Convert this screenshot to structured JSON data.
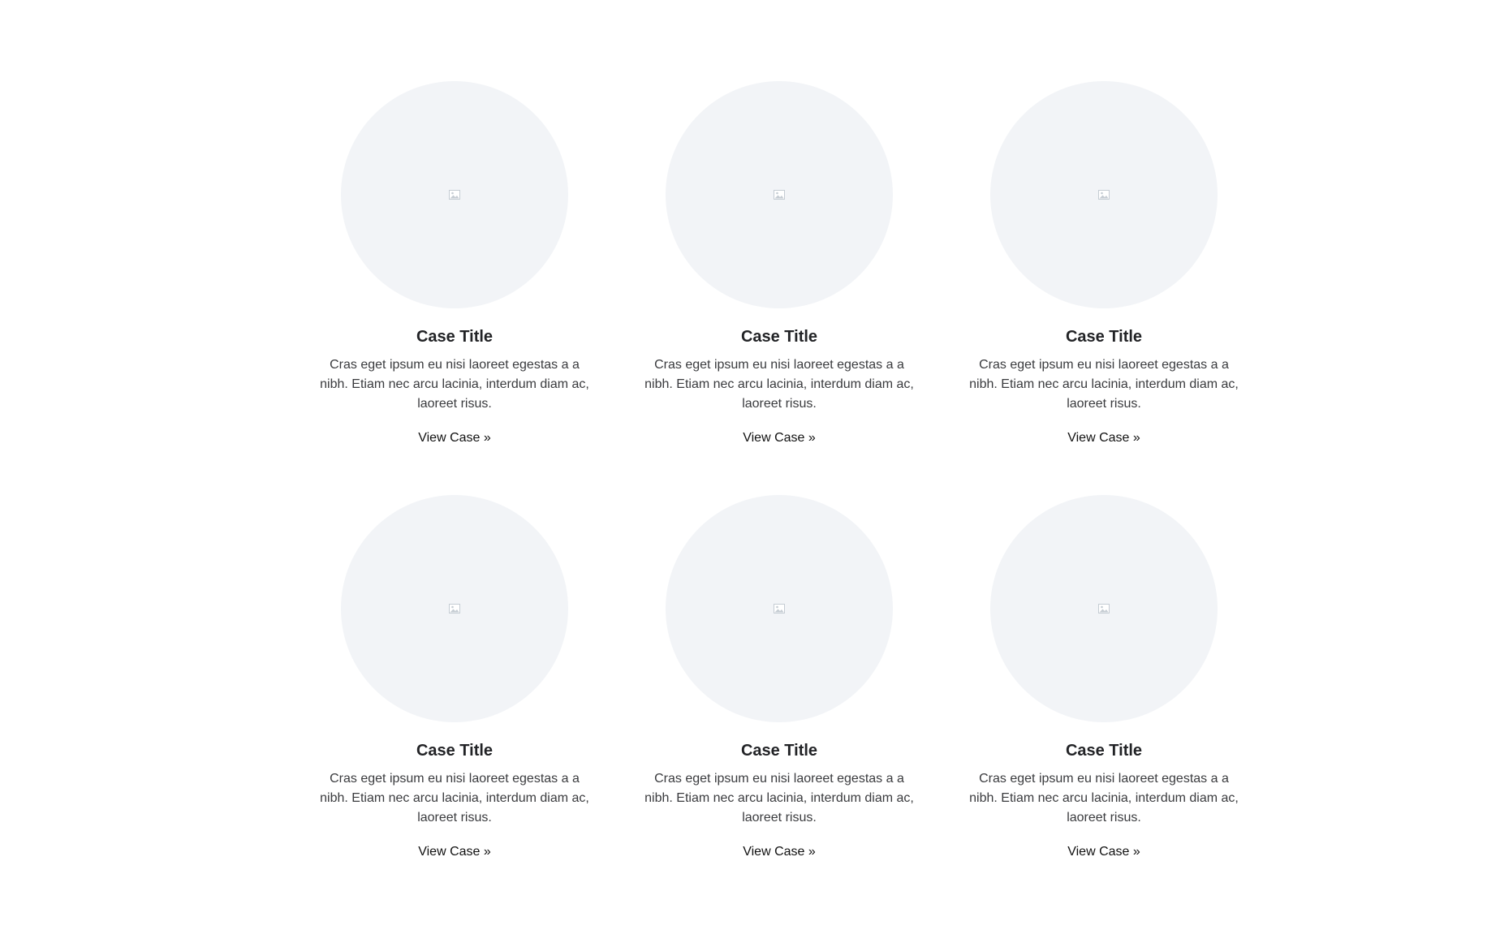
{
  "cases": [
    {
      "title": "Case Title",
      "description": "Cras eget ipsum eu nisi laoreet egestas a a nibh. Etiam nec arcu lacinia, interdum diam ac, laoreet risus.",
      "link_label": "View Case »",
      "image_icon": "broken-image-icon"
    },
    {
      "title": "Case Title",
      "description": "Cras eget ipsum eu nisi laoreet egestas a a nibh. Etiam nec arcu lacinia, interdum diam ac, laoreet risus.",
      "link_label": "View Case »",
      "image_icon": "broken-image-icon"
    },
    {
      "title": "Case Title",
      "description": "Cras eget ipsum eu nisi laoreet egestas a a nibh. Etiam nec arcu lacinia, interdum diam ac, laoreet risus.",
      "link_label": "View Case »",
      "image_icon": "broken-image-icon"
    },
    {
      "title": "Case Title",
      "description": "Cras eget ipsum eu nisi laoreet egestas a a nibh. Etiam nec arcu lacinia, interdum diam ac, laoreet risus.",
      "link_label": "View Case »",
      "image_icon": "broken-image-icon"
    },
    {
      "title": "Case Title",
      "description": "Cras eget ipsum eu nisi laoreet egestas a a nibh. Etiam nec arcu lacinia, interdum diam ac, laoreet risus.",
      "link_label": "View Case »",
      "image_icon": "broken-image-icon"
    },
    {
      "title": "Case Title",
      "description": "Cras eget ipsum eu nisi laoreet egestas a a nibh. Etiam nec arcu lacinia, interdum diam ac, laoreet risus.",
      "link_label": "View Case »",
      "image_icon": "broken-image-icon"
    }
  ],
  "colors": {
    "image_placeholder_bg": "#f2f4f7",
    "title_text": "#222326",
    "body_text": "#3a3b3e",
    "link_text": "#111111"
  }
}
